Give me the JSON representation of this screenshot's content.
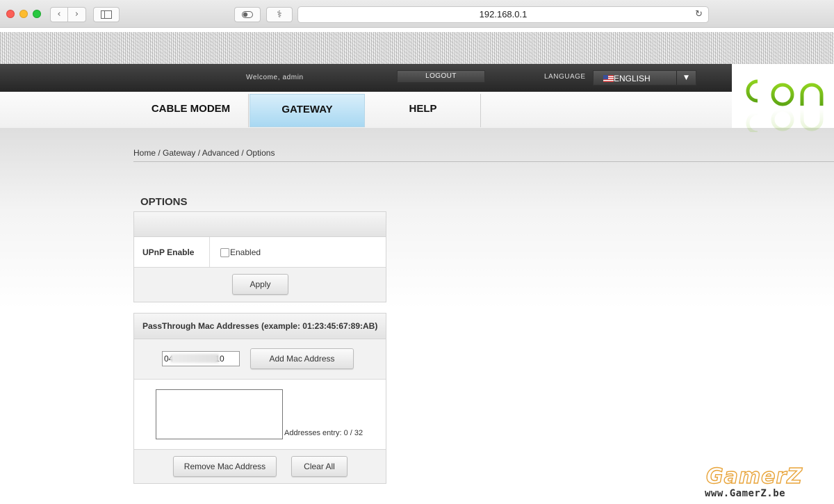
{
  "browser": {
    "back_icon": "chevron-left-icon",
    "forward_icon": "chevron-right-icon",
    "sidebar_icon": "sidebar-icon",
    "privacy_icon": "toggle-icon",
    "extension_icon": "extension-icon",
    "address": "192.168.0.1",
    "reload_icon": "reload-icon"
  },
  "topbar": {
    "welcome": "Welcome, admin",
    "logout": "LOGOUT",
    "language_label": "LANGUAGE",
    "language_value": "ENGLISH"
  },
  "logo": {
    "text": "cbn"
  },
  "nav": {
    "tabs": [
      {
        "label": "CABLE MODEM",
        "active": false
      },
      {
        "label": "GATEWAY",
        "active": true
      },
      {
        "label": "HELP",
        "active": false
      }
    ]
  },
  "breadcrumb": "Home / Gateway / Advanced / Options",
  "page_title": "OPTIONS",
  "options_panel": {
    "header": "",
    "upnp_label": "UPnP Enable",
    "upnp_checkbox_label": "Enabled",
    "upnp_checked": false,
    "apply": "Apply"
  },
  "passthrough_panel": {
    "header": "PassThrough Mac Addresses (example: 01:23:45:67:89:AB)",
    "mac_input_value": "04                  10",
    "add_button": "Add Mac Address",
    "entry_count": "Addresses entry: 0 / 32",
    "remove_button": "Remove Mac Address",
    "clear_button": "Clear All"
  },
  "watermark": {
    "name": "GamerZ",
    "url": "www.GamerZ.be"
  },
  "colors": {
    "active_tab": "#a8d8f2",
    "topbar": "#2e2e2e",
    "logo_green": "#7ac21b"
  }
}
